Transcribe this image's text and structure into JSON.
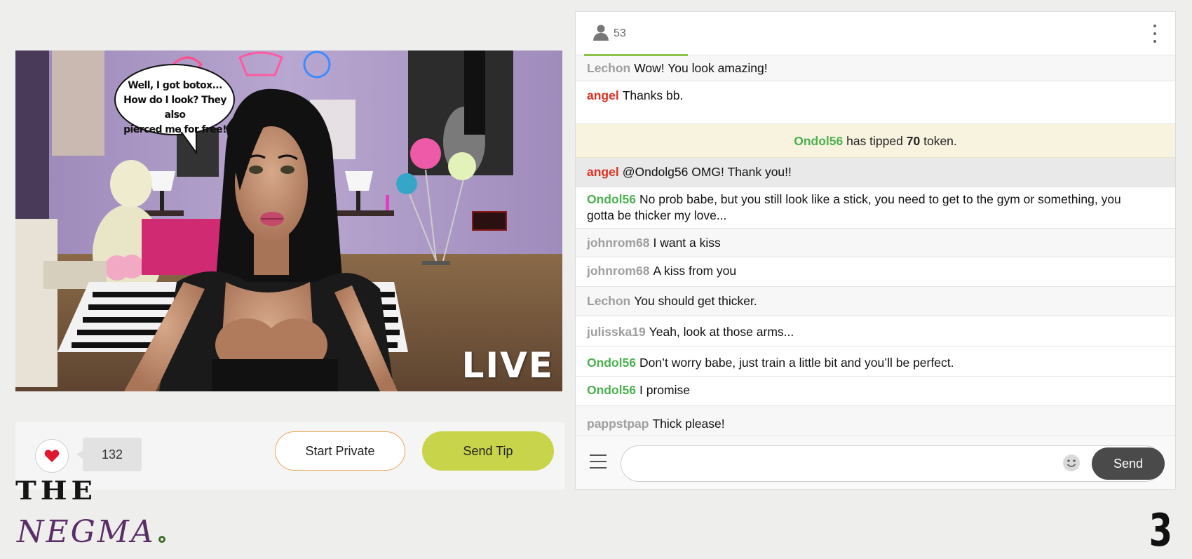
{
  "stream": {
    "live_label": "LIVE",
    "speech_bubble": [
      "Well, I got botox...",
      "How do I look? They also",
      "pierced me for free!"
    ]
  },
  "actions": {
    "like_count": "132",
    "start_private_label": "Start Private",
    "send_tip_label": "Send Tip"
  },
  "chat": {
    "viewer_count": "53",
    "messages": [
      {
        "user": "Lechon",
        "user_color": "#9e9e9e",
        "text": "Wow! You look amazing!"
      },
      {
        "user": "angel",
        "user_color": "#e03020",
        "text": "Thanks bb."
      },
      {
        "user": "angel",
        "user_color": "#e03020",
        "text": "@Ondolg56  OMG! Thank you!!"
      },
      {
        "user": "Ondol56",
        "user_color": "#4caf50",
        "text": "No prob babe, but you still look like a stick, you need to get to the gym or something, you gotta be thicker my love..."
      },
      {
        "user": "johnrom68",
        "user_color": "#9e9e9e",
        "text": "I want a kiss"
      },
      {
        "user": "johnrom68",
        "user_color": "#9e9e9e",
        "text": "A kiss from you"
      },
      {
        "user": "Lechon",
        "user_color": "#9e9e9e",
        "text": "You should get thicker."
      },
      {
        "user": "julisska19",
        "user_color": "#9e9e9e",
        "text": "Yeah, look at those arms..."
      },
      {
        "user": "Ondol56",
        "user_color": "#4caf50",
        "text": "Don’t worry babe, just train a little bit and you’ll be perfect."
      },
      {
        "user": "Ondol56",
        "user_color": "#4caf50",
        "text": "I promise"
      },
      {
        "user": "pappstpap",
        "user_color": "#9e9e9e",
        "text": "Thick please!"
      }
    ],
    "tip": {
      "user": "Ondol56",
      "pre": "has tipped",
      "amount": "70",
      "post": "token."
    },
    "input": {
      "value": "",
      "placeholder": ""
    },
    "send_label": "Send"
  },
  "branding": {
    "line1": "THE",
    "line2": "NEGMA",
    "page_number": "3"
  },
  "colors": {
    "tip_button": "#c8d44a",
    "private_border": "#e8a95a",
    "heart": "#e0182d",
    "green_user": "#4caf50",
    "red_user": "#e03020",
    "gray_user": "#9e9e9e",
    "send_button": "#4a4a4a"
  },
  "icons": [
    "user-icon",
    "kebab-menu-icon",
    "heart-icon",
    "hamburger-menu-icon",
    "emoji-icon"
  ]
}
